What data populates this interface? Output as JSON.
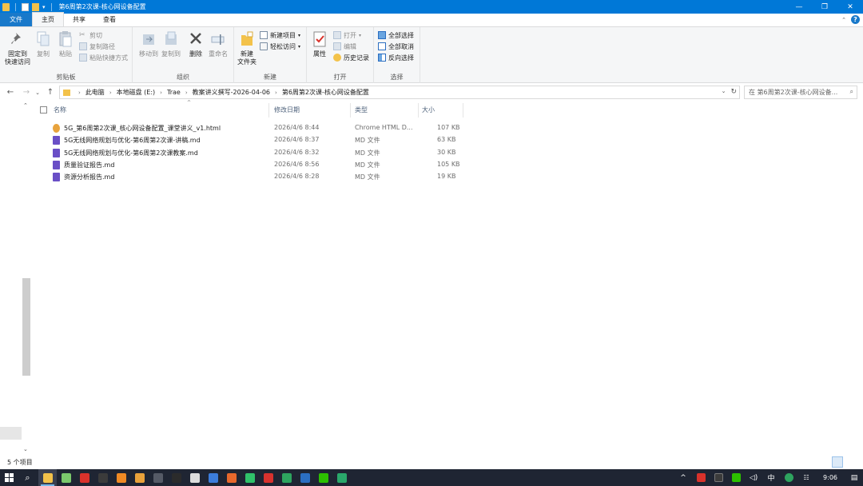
{
  "window": {
    "title": "第6周第2次课-核心网设备配置",
    "controls": {
      "minimize": "—",
      "maximize": "❐",
      "close": "✕"
    }
  },
  "ribbon_tabs": [
    {
      "label": "文件"
    },
    {
      "label": "主页"
    },
    {
      "label": "共享"
    },
    {
      "label": "查看"
    }
  ],
  "ribbon": {
    "clipboard": {
      "pin_label_1": "固定到",
      "pin_label_2": "快速访问",
      "copy": "复制",
      "paste": "粘贴",
      "cut": "剪切",
      "copy_path": "复制路径",
      "paste_shortcut": "粘贴快捷方式",
      "group": "剪贴板"
    },
    "organize": {
      "move_to": "移动到",
      "copy_to": "复制到",
      "delete": "删除",
      "rename": "重命名",
      "group": "组织"
    },
    "new": {
      "new_folder_1": "新建",
      "new_folder_2": "文件夹",
      "new_item": "新建项目",
      "easy_access": "轻松访问",
      "group": "新建"
    },
    "open": {
      "properties": "属性",
      "open": "打开",
      "edit": "编辑",
      "history": "历史记录",
      "group": "打开"
    },
    "select": {
      "select_all": "全部选择",
      "select_none": "全部取消",
      "invert": "反向选择",
      "group": "选择"
    }
  },
  "address": {
    "crumbs": [
      "此电脑",
      "本地磁盘 (E:)",
      "Trae",
      "教案讲义撰写-2026-04-06",
      "第6周第2次课-核心网设备配置"
    ],
    "search_placeholder": "在 第6周第2次课-核心网设备..."
  },
  "columns": {
    "name": "名称",
    "modified": "修改日期",
    "type": "类型",
    "size": "大小"
  },
  "files": [
    {
      "name": "5G_第6周第2次课_核心网设备配置_课堂讲义_v1.html",
      "modified": "2026/4/6 8:44",
      "type": "Chrome HTML D...",
      "size": "107 KB",
      "icon": "chrome-html-icon",
      "color": "#e8a33d"
    },
    {
      "name": "5G无线网络规划与优化-第6周第2次课-讲稿.md",
      "modified": "2026/4/6 8:37",
      "type": "MD 文件",
      "size": "63 KB",
      "icon": "md-file-icon",
      "color": "#6a4fc6"
    },
    {
      "name": "5G无线网络规划与优化-第6周第2次课教案.md",
      "modified": "2026/4/6 8:32",
      "type": "MD 文件",
      "size": "30 KB",
      "icon": "md-file-icon",
      "color": "#6a4fc6"
    },
    {
      "name": "质量验证报告.md",
      "modified": "2026/4/6 8:56",
      "type": "MD 文件",
      "size": "105 KB",
      "icon": "md-file-icon",
      "color": "#6a4fc6"
    },
    {
      "name": "资源分析报告.md",
      "modified": "2026/4/6 8:28",
      "type": "MD 文件",
      "size": "19 KB",
      "icon": "md-file-icon",
      "color": "#6a4fc6"
    }
  ],
  "status": {
    "count": "5 个项目"
  },
  "taskbar": {
    "apps": [
      {
        "icon": "file-explorer-icon",
        "color": "#f3c24a",
        "active": true
      },
      {
        "icon": "notepad-icon",
        "color": "#7bc86c"
      },
      {
        "icon": "wps-icon",
        "color": "#d9322b"
      },
      {
        "icon": "app-a-icon",
        "color": "#3b3b3b"
      },
      {
        "icon": "search-app-icon",
        "color": "#f08a24"
      },
      {
        "icon": "chrome-icon",
        "color": "#e9a23b"
      },
      {
        "icon": "media-icon",
        "color": "#555a66"
      },
      {
        "icon": "obs-icon",
        "color": "#2b2b2b"
      },
      {
        "icon": "github-icon",
        "color": "#dddddd"
      },
      {
        "icon": "app-blue-icon",
        "color": "#3c7ddc"
      },
      {
        "icon": "app-orange-icon",
        "color": "#e8682c"
      },
      {
        "icon": "terminal-icon",
        "color": "#30c26a"
      },
      {
        "icon": "app-red-icon",
        "color": "#d8322e"
      },
      {
        "icon": "app-green-icon",
        "color": "#2ea45f"
      },
      {
        "icon": "powershell-icon",
        "color": "#2b6ec1"
      },
      {
        "icon": "wechat-icon",
        "color": "#2dc100"
      },
      {
        "icon": "app-screen-icon",
        "color": "#2aa86b"
      }
    ],
    "ime": "中",
    "time": "9:06"
  }
}
